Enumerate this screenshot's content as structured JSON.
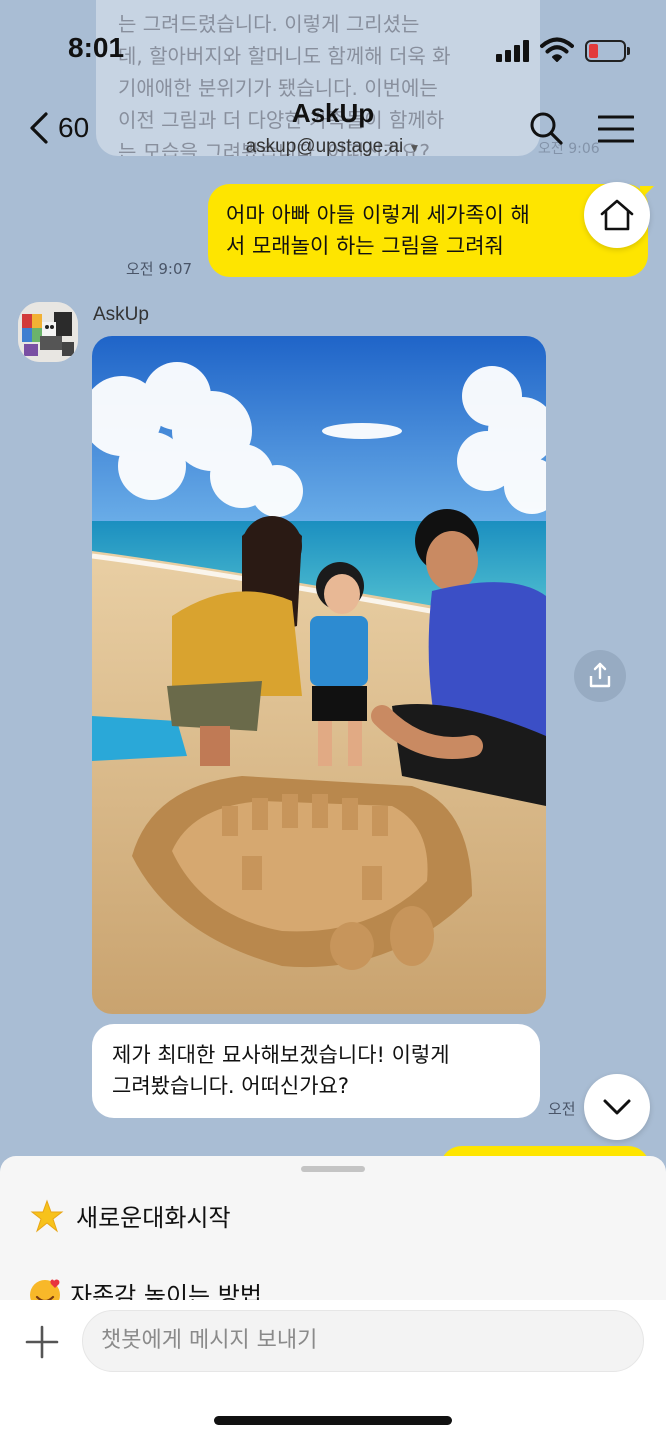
{
  "status": {
    "time": "8:01"
  },
  "header": {
    "back_count": "60",
    "title": "AskUp",
    "subtitle": "askup@upstage.ai"
  },
  "previous_message": {
    "lines": [
      "는 그려드렸습니다. 이렇게 그리셨는",
      "데, 할아버지와 할머니도 함께해 더욱 화",
      "기애애한 분위기가 됐습니다. 이번에는",
      "이전 그림과 더 다양한 가족들이 함께하",
      "는 모습을 그려봤습니다. 어떠신가요?"
    ],
    "time": "오전 9:06"
  },
  "messages": {
    "user_1": {
      "line1": "어마 아빠 아들 이렇게 세가족이 해",
      "line2": "서 모래놀이 하는 그림을 그려줘",
      "time": "오전 9:07"
    },
    "bot": {
      "name": "AskUp",
      "line1": "제가 최대한 묘사해보겠습니다!  이렇게",
      "line2": "그려봤습니다. 어떠신가요?",
      "time": "오전"
    }
  },
  "quick_replies": [
    {
      "icon": "star-emoji",
      "label": "새로운대화시작"
    },
    {
      "icon": "smiling-hearts-emoji",
      "label": "자존감 높이는 방법"
    }
  ],
  "input": {
    "placeholder": "챗봇에게 메시지 보내기"
  },
  "colors": {
    "background": "#a9bdd4",
    "user_bubble": "#fee500",
    "bot_bubble": "#ffffff",
    "battery_low": "#e23b3b"
  }
}
